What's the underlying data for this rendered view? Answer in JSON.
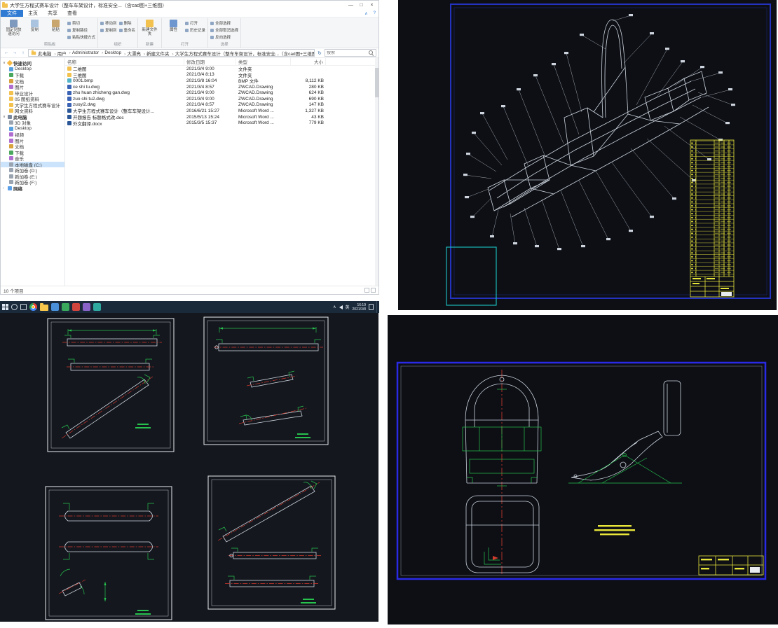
{
  "colors": {
    "accent-blue": "#2f7bd3",
    "taskbar-bg": "#1b2a3a",
    "cad-bg": "#0d0f15",
    "cad-bg2": "#14171e",
    "cad-blue": "#2333c0",
    "cad-blue2": "#2a2ae6",
    "cad-cyan": "#1bc7c7",
    "cad-yellow": "#e9e63a",
    "cad-green": "#27c24e",
    "cad-red": "#d23a2e",
    "cad-wire": "#cdd4dd",
    "panel-frame": "#e8ebef"
  },
  "explorer": {
    "title": "大学生方程式赛车设计（整车车架设计，标准安全...（含cad图+三维图）",
    "controls": {
      "minimize": "—",
      "maximize": "□",
      "close": "×"
    },
    "tabs": {
      "file": "文件",
      "home": "主页",
      "share": "共享",
      "view": "查看"
    },
    "glyphs": {
      "back": "←",
      "forward": "→",
      "up": "↑",
      "dropdown": "∨",
      "collapse": "∧",
      "help": "?",
      "refresh": "↻"
    },
    "ribbon": {
      "pin": "固定到快速访问",
      "copy": "复制",
      "paste": "粘贴",
      "cut": "剪切",
      "copy_path": "复制路径",
      "paste_shortcut": "粘贴快捷方式",
      "move_to": "移动到",
      "copy_to": "复制到",
      "delete": "删除",
      "rename": "重命名",
      "new_folder": "新建文件夹",
      "properties": "属性",
      "open": "打开",
      "history": "历史记录",
      "select_all": "全部选择",
      "select_none": "全部取消选择",
      "invert_selection": "反向选择",
      "groups": {
        "clipboard": "剪贴板",
        "organize": "组织",
        "new": "新建",
        "open": "打开",
        "select": "选择"
      }
    },
    "address": {
      "crumbs": [
        "此电脑",
        "用户",
        "Administrator",
        "Desktop",
        "大漂亮",
        "新建文件夹",
        "大学生方程式赛车设计（整车车架设计，标准安全...（含cad图+三维图）"
      ]
    },
    "search_placeholder": "搜索",
    "nav": {
      "quick_access_label": "快速访问",
      "quick_access": [
        "Desktop",
        "下载",
        "文档",
        "图片",
        "毕业设计",
        "05 图纸资料",
        "大学生方程式赛车设计",
        "网文资料"
      ],
      "this_pc_label": "此电脑",
      "this_pc": [
        "3D 对象",
        "Desktop",
        "视频",
        "图片",
        "文档",
        "下载",
        "音乐",
        "本地磁盘 (C:)",
        "新加卷 (D:)",
        "新加卷 (E:)",
        "新加卷 (F:)"
      ],
      "network_label": "网络"
    },
    "list": {
      "columns": [
        "名称",
        "修改日期",
        "类型",
        "大小"
      ],
      "files": [
        {
          "name": "二维图",
          "date": "2021/3/4 9:00",
          "type": "文件夹",
          "size": ""
        },
        {
          "name": "三维图",
          "date": "2021/3/4 8:13",
          "type": "文件夹",
          "size": ""
        },
        {
          "name": "0001.bmp",
          "date": "2021/3/8 16:04",
          "type": "BMP 文件",
          "size": "8,112 KB"
        },
        {
          "name": "ce shi tu.dwg",
          "date": "2021/3/4 8:57",
          "type": "ZWCAD.Drawing",
          "size": "280 KB"
        },
        {
          "name": "zhu huan zhicheng gan.dwg",
          "date": "2021/3/4 9:00",
          "type": "ZWCAD.Drawing",
          "size": "624 KB"
        },
        {
          "name": "zuo shi tu2.dwg",
          "date": "2021/3/4 9:00",
          "type": "ZWCAD.Drawing",
          "size": "690 KB"
        },
        {
          "name": "zuoyi2.dwg",
          "date": "2021/3/4 8:57",
          "type": "ZWCAD.Drawing",
          "size": "147 KB"
        },
        {
          "name": "大学生方程式赛车设计（整车车架设计...",
          "date": "2016/6/21 15:27",
          "type": "Microsoft Word ...",
          "size": "1,327 KB"
        },
        {
          "name": "开题报告 标题格式改.doc",
          "date": "2015/5/13 15:24",
          "type": "Microsoft Word ...",
          "size": "43 KB"
        },
        {
          "name": "外文翻译.docx",
          "date": "2015/3/5 15:37",
          "type": "Microsoft Word ...",
          "size": "779 KB"
        }
      ]
    },
    "status": "10 个项目"
  },
  "taskbar": {
    "time": "16:19",
    "date": "2021/3/8",
    "ime": "英",
    "chevron": "∧"
  }
}
